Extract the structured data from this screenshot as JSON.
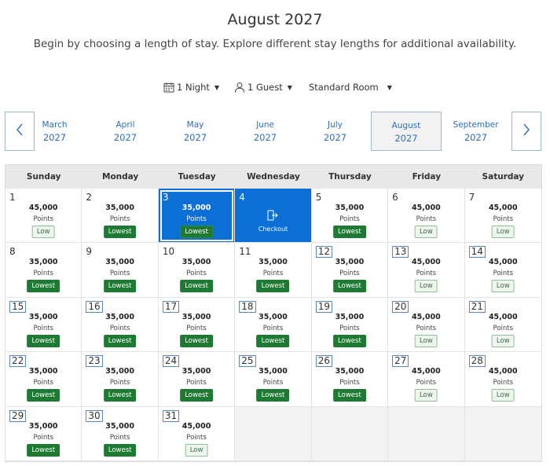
{
  "header": {
    "title": "August 2027",
    "subtitle": "Begin by choosing a length of stay. Explore different stay lengths for additional availability."
  },
  "controls": {
    "nights": "1 Night",
    "guests": "1 Guest",
    "room": "Standard Room",
    "caret": "▼"
  },
  "months": [
    {
      "name": "March",
      "year": "2027",
      "selected": false
    },
    {
      "name": "April",
      "year": "2027",
      "selected": false
    },
    {
      "name": "May",
      "year": "2027",
      "selected": false
    },
    {
      "name": "June",
      "year": "2027",
      "selected": false
    },
    {
      "name": "July",
      "year": "2027",
      "selected": false
    },
    {
      "name": "August",
      "year": "2027",
      "selected": true
    },
    {
      "name": "September",
      "year": "2027",
      "selected": false
    }
  ],
  "weekdays": [
    "Sunday",
    "Monday",
    "Tuesday",
    "Wednesday",
    "Thursday",
    "Friday",
    "Saturday"
  ],
  "points_label": "Points",
  "checkout_label": "Checkout",
  "leading_blanks": 0,
  "days": [
    {
      "day": "1",
      "points": "45,000",
      "badge": "Low",
      "boxed": false
    },
    {
      "day": "2",
      "points": "35,000",
      "badge": "Lowest",
      "boxed": false
    },
    {
      "day": "3",
      "points": "35,000",
      "badge": "Lowest",
      "boxed": false,
      "state": "checkin"
    },
    {
      "day": "4",
      "points": "",
      "badge": "",
      "boxed": false,
      "state": "checkout"
    },
    {
      "day": "5",
      "points": "35,000",
      "badge": "Lowest",
      "boxed": false
    },
    {
      "day": "6",
      "points": "45,000",
      "badge": "Low",
      "boxed": false
    },
    {
      "day": "7",
      "points": "45,000",
      "badge": "Low",
      "boxed": false
    },
    {
      "day": "8",
      "points": "35,000",
      "badge": "Lowest",
      "boxed": false
    },
    {
      "day": "9",
      "points": "35,000",
      "badge": "Lowest",
      "boxed": false
    },
    {
      "day": "10",
      "points": "35,000",
      "badge": "Lowest",
      "boxed": false
    },
    {
      "day": "11",
      "points": "35,000",
      "badge": "Lowest",
      "boxed": false
    },
    {
      "day": "12",
      "points": "35,000",
      "badge": "Lowest",
      "boxed": true
    },
    {
      "day": "13",
      "points": "45,000",
      "badge": "Low",
      "boxed": true
    },
    {
      "day": "14",
      "points": "45,000",
      "badge": "Low",
      "boxed": true
    },
    {
      "day": "15",
      "points": "35,000",
      "badge": "Lowest",
      "boxed": true
    },
    {
      "day": "16",
      "points": "35,000",
      "badge": "Lowest",
      "boxed": true
    },
    {
      "day": "17",
      "points": "35,000",
      "badge": "Lowest",
      "boxed": true
    },
    {
      "day": "18",
      "points": "35,000",
      "badge": "Lowest",
      "boxed": true
    },
    {
      "day": "19",
      "points": "35,000",
      "badge": "Lowest",
      "boxed": true
    },
    {
      "day": "20",
      "points": "45,000",
      "badge": "Low",
      "boxed": true
    },
    {
      "day": "21",
      "points": "45,000",
      "badge": "Low",
      "boxed": true
    },
    {
      "day": "22",
      "points": "35,000",
      "badge": "Lowest",
      "boxed": true
    },
    {
      "day": "23",
      "points": "35,000",
      "badge": "Lowest",
      "boxed": true
    },
    {
      "day": "24",
      "points": "35,000",
      "badge": "Lowest",
      "boxed": true
    },
    {
      "day": "25",
      "points": "35,000",
      "badge": "Lowest",
      "boxed": true
    },
    {
      "day": "26",
      "points": "35,000",
      "badge": "Lowest",
      "boxed": true
    },
    {
      "day": "27",
      "points": "45,000",
      "badge": "Low",
      "boxed": true
    },
    {
      "day": "28",
      "points": "45,000",
      "badge": "Low",
      "boxed": true
    },
    {
      "day": "29",
      "points": "35,000",
      "badge": "Lowest",
      "boxed": true
    },
    {
      "day": "30",
      "points": "35,000",
      "badge": "Lowest",
      "boxed": true
    },
    {
      "day": "31",
      "points": "45,000",
      "badge": "Low",
      "boxed": true
    }
  ],
  "colors": {
    "accent": "#0b6fd6",
    "link": "#2a6ebf",
    "lowest_badge": "#1e7a33",
    "low_badge_bg": "#eef5ee"
  },
  "icons": {
    "nights": "calendar-icon",
    "guests": "person-icon",
    "prev": "chevron-left-icon",
    "next": "chevron-right-icon",
    "checkout": "exit-door-icon"
  }
}
